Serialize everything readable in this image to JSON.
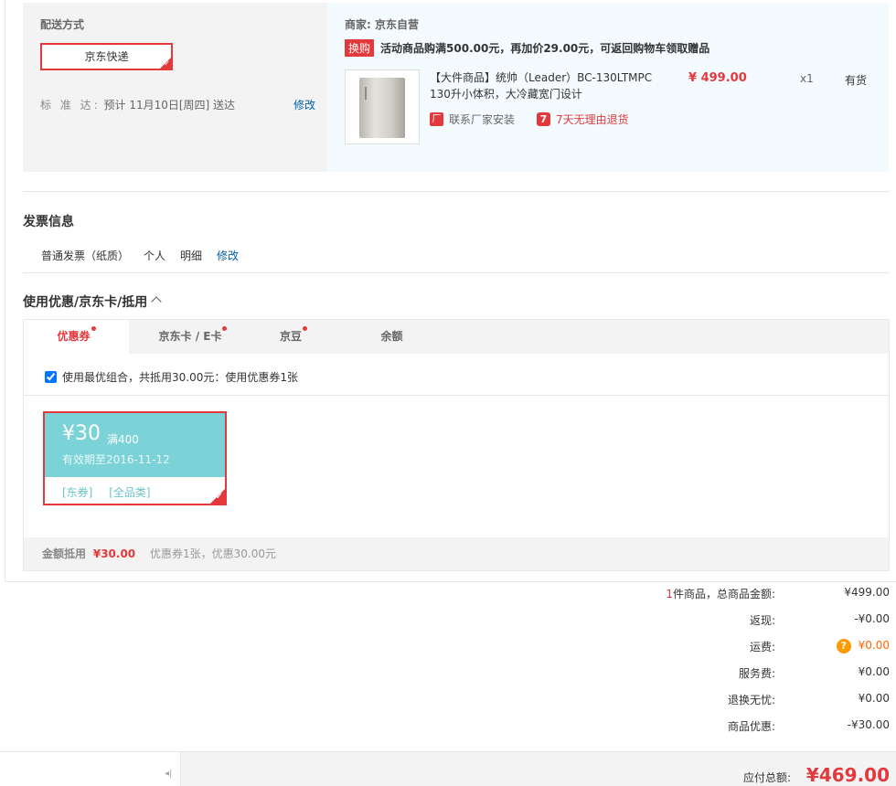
{
  "delivery": {
    "title": "配送方式",
    "method": "京东快递",
    "standard_label": "标 准 达:",
    "standard_text": "预计 11月10日[周四] 送达",
    "edit": "修改"
  },
  "seller": {
    "title": "商家: 京东自营",
    "promo_tag": "换购",
    "promo_text": "活动商品购满500.00元，再加价29.00元，可返回购物车领取赠品",
    "product": {
      "name": "【大件商品】统帅（Leader）BC-130LTMPC 130升小体积，大冷藏宽门设计",
      "price": "¥ 499.00",
      "qty": "x1",
      "stock": "有货"
    },
    "services": [
      {
        "icon": "factory-icon",
        "glyph": "厂",
        "label": "联系厂家安装"
      },
      {
        "icon": "seven-day-return-icon",
        "glyph": "7",
        "label": "7天无理由退货"
      }
    ]
  },
  "invoice": {
    "title": "发票信息",
    "items": [
      "普通发票（纸质）",
      "个人",
      "明细"
    ],
    "edit": "修改"
  },
  "discount": {
    "title": "使用优惠/京东卡/抵用",
    "tabs": [
      {
        "label": "优惠券",
        "dot": true
      },
      {
        "label": "京东卡 / E卡",
        "dot": true
      },
      {
        "label": "京豆",
        "dot": true
      },
      {
        "label": "余额",
        "dot": false
      }
    ],
    "best_combo": "使用最优组合，共抵用30.00元：使用优惠券1张",
    "coupon": {
      "amount": "¥30",
      "limit": "满400",
      "expiry": "有效期至2016-11-12",
      "tags": [
        "[东券]",
        "[全品类]"
      ]
    },
    "footer_label": "金额抵用",
    "footer_value": "¥30.00",
    "footer_desc": "优惠券1张，优惠30.00元"
  },
  "summary": {
    "count": "1",
    "count_label": "件商品，总商品金额:",
    "items": [
      {
        "label": "总商品金额",
        "value": "¥499.00"
      },
      {
        "label": "返现:",
        "value": "-¥0.00"
      },
      {
        "label": "运费:",
        "value": "¥0.00"
      },
      {
        "label": "服务费:",
        "value": "¥0.00"
      },
      {
        "label": "退换无忧:",
        "value": "¥0.00"
      },
      {
        "label": "商品优惠:",
        "value": "-¥30.00"
      }
    ],
    "shipping_help": "?"
  },
  "total": {
    "label": "应付总额:",
    "value": "¥469.00"
  },
  "colors": {
    "accent": "#e4393c",
    "link": "#005ea7",
    "coupon": "#7bd2d7",
    "warning": "#ff9900"
  }
}
